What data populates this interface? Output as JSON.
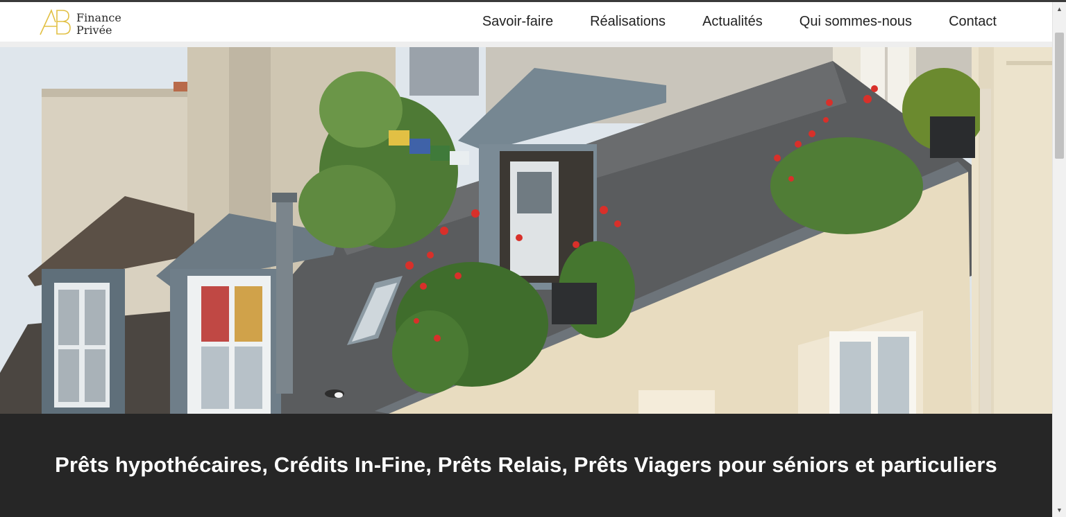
{
  "brand": {
    "line1": "Finance",
    "line2": "Privée",
    "logo_color": "#e2c044"
  },
  "nav": {
    "items": [
      {
        "label": "Savoir-faire"
      },
      {
        "label": "Réalisations"
      },
      {
        "label": "Actualités"
      },
      {
        "label": "Qui sommes-nous"
      },
      {
        "label": "Contact"
      }
    ]
  },
  "hero": {
    "image_icon": "paris-rooftop-photo"
  },
  "banner": {
    "text": "Prêts hypothécaires, Crédits In-Fine, Prêts Relais, Prêts Viagers pour séniors et particuliers",
    "background": "#262626"
  },
  "scrollbar": {
    "up_icon": "scroll-up-arrow-icon",
    "down_icon": "scroll-down-arrow-icon"
  }
}
